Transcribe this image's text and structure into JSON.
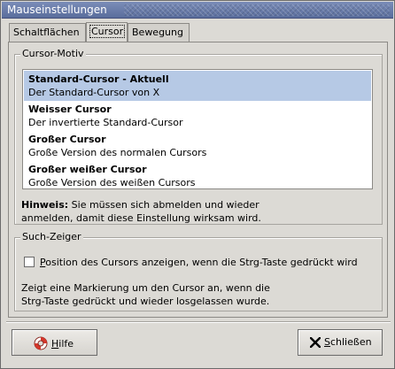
{
  "window": {
    "title": "Mauseinstellungen"
  },
  "tabs": [
    {
      "label": "Schaltflächen"
    },
    {
      "label": "Cursor"
    },
    {
      "label": "Bewegung"
    }
  ],
  "cursor_theme": {
    "label": "Cursor-Motiv",
    "items": [
      {
        "title": "Standard-Cursor - Aktuell",
        "desc": "Der Standard-Cursor von X",
        "selected": true
      },
      {
        "title": "Weisser Cursor",
        "desc": "Der invertierte Standard-Cursor",
        "selected": false
      },
      {
        "title": "Großer Cursor",
        "desc": "Große Version des normalen Cursors",
        "selected": false
      },
      {
        "title": "Großer weißer Cursor",
        "desc": "Große Version des weißen Cursors",
        "selected": false
      }
    ],
    "hint_label": "Hinweis:",
    "hint_line1": " Sie müssen sich abmelden und wieder",
    "hint_line2": "anmelden, damit diese Einstellung wirksam wird."
  },
  "locate_pointer": {
    "label": "Such-Zeiger",
    "checkbox_mnemonic": "P",
    "checkbox_label": "osition des Cursors anzeigen, wenn die Strg-Taste gedrückt wird",
    "checked": false,
    "desc_line1": "Zeigt eine Markierung um den Cursor an, wenn die",
    "desc_line2": "Strg-Taste gedrückt und wieder losgelassen wurde."
  },
  "buttons": {
    "help_mnemonic": "H",
    "help_label": "ilfe",
    "close_mnemonic": "S",
    "close_label": "chließen"
  },
  "colors": {
    "title_bar": "#6a7daa",
    "selection": "#b6c9e5",
    "help_icon": "#d4372b"
  }
}
